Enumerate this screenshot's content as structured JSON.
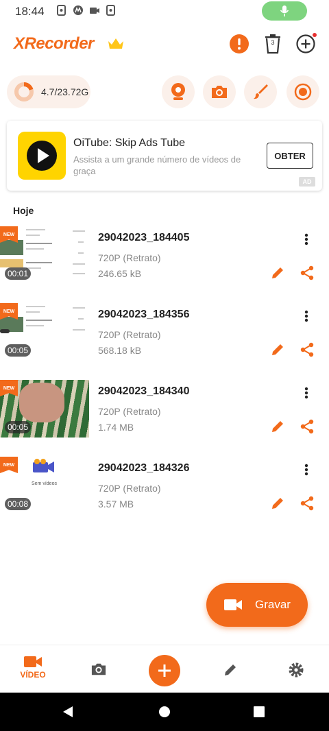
{
  "status_bar": {
    "time": "18:44"
  },
  "header": {
    "app_name": "XRecorder"
  },
  "header_actions": {
    "trash_count": "3"
  },
  "storage": {
    "text": "4.7/23.72G",
    "used_fraction": 0.2
  },
  "ad": {
    "title": "OiTube: Skip Ads Tube",
    "description": "Assista a um grande número de vídeos de graça",
    "button": "OBTER",
    "badge": "AD"
  },
  "section": {
    "label": "Hoje"
  },
  "videos": [
    {
      "name": "29042023_184405",
      "resolution": "720P (Retrato)",
      "size": "246.65 kB",
      "duration": "00:01",
      "tag": "NEW"
    },
    {
      "name": "29042023_184356",
      "resolution": "720P (Retrato)",
      "size": "568.18 kB",
      "duration": "00:05",
      "tag": "NEW"
    },
    {
      "name": "29042023_184340",
      "resolution": "720P (Retrato)",
      "size": "1.74 MB",
      "duration": "00:05",
      "tag": "NEW"
    },
    {
      "name": "29042023_184326",
      "resolution": "720P (Retrato)",
      "size": "3.57 MB",
      "duration": "00:08",
      "tag": "NEW",
      "thumb_caption": "Sem vídeos"
    }
  ],
  "fab": {
    "label": "Gravar"
  },
  "bottom_nav": {
    "video_label": "VÍDEO"
  },
  "colors": {
    "accent": "#f26a1b",
    "mic_pill": "#7ed47f",
    "ad_icon": "#ffd400"
  }
}
